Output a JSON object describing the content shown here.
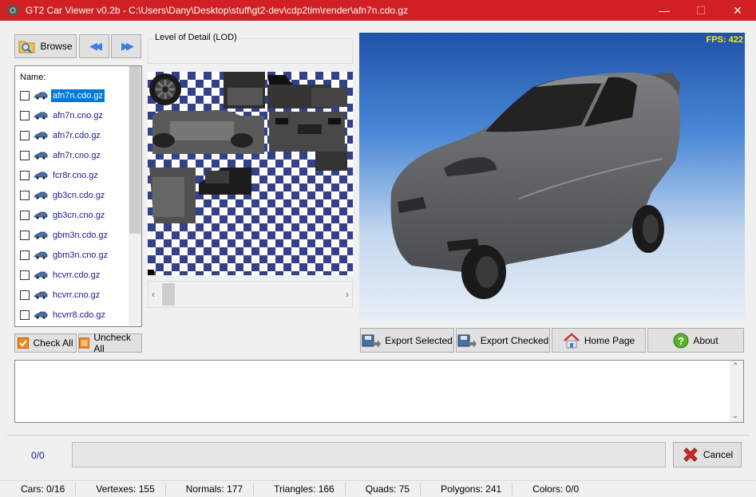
{
  "window": {
    "title": "GT2 Car Viewer v0.2b - C:\\Users\\Dany\\Desktop\\stuff\\gt2-dev\\cdp2tim\\render\\afn7n.cdo.gz",
    "minimize_glyph": "—",
    "maximize_glyph": "☐",
    "close_glyph": "✕"
  },
  "toolbar": {
    "browse_label": "Browse",
    "prev_glyph": "◀◀",
    "next_glyph": "▶▶"
  },
  "lod": {
    "label": "Level of Detail (LOD)"
  },
  "file_list": {
    "header": "Name:",
    "selected_index": 0,
    "items": [
      {
        "name": "afn7n.cdo.gz"
      },
      {
        "name": "afn7n.cno.gz"
      },
      {
        "name": "afn7r.cdo.gz"
      },
      {
        "name": "afn7r.cno.gz"
      },
      {
        "name": "fcr8r.cno.gz"
      },
      {
        "name": "gb3cn.cdo.gz"
      },
      {
        "name": "gb3cn.cno.gz"
      },
      {
        "name": "gbm3n.cdo.gz"
      },
      {
        "name": "gbm3n.cno.gz"
      },
      {
        "name": "hcvrr.cdo.gz"
      },
      {
        "name": "hcvrr.cno.gz"
      },
      {
        "name": "hcvrr8.cdo.gz"
      }
    ]
  },
  "check_buttons": {
    "check_all": "Check All",
    "uncheck_all": "Uncheck All"
  },
  "texture_scroll": {
    "left_glyph": "‹",
    "right_glyph": "›"
  },
  "viewport": {
    "fps_label": "FPS: 422"
  },
  "actions": {
    "export_selected": "Export Selected",
    "export_checked": "Export Checked",
    "home_page": "Home Page",
    "about": "About"
  },
  "log": {
    "up_glyph": "⌃",
    "down_glyph": "⌄"
  },
  "progress": {
    "count_text": "0/0",
    "fraction": 0,
    "cancel_label": "Cancel"
  },
  "status": {
    "cars": "Cars: 0/16",
    "vertexes": "Vertexes: 155",
    "normals": "Normals: 177",
    "triangles": "Triangles: 166",
    "quads": "Quads: 75",
    "polygons": "Polygons: 241",
    "colors": "Colors: 0/0"
  },
  "colors": {
    "titlebar": "#d02023",
    "selection": "#0078d7",
    "link_text": "#1a1a8c",
    "fps_text": "#ffee00",
    "checker_dark": "#33408a",
    "car_body": "#5f6164"
  }
}
